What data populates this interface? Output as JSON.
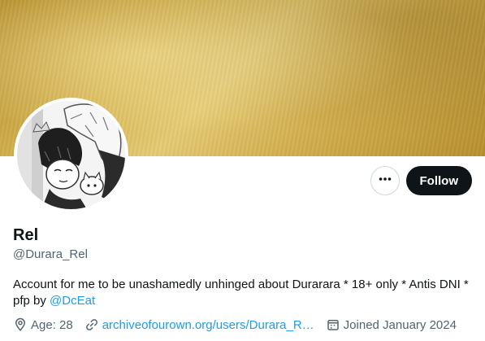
{
  "profile": {
    "name": "Rel",
    "handle": "@Durara_Rel",
    "bio_text": "Account for me to be unashamedly unhinged about Durarara * 18+ only * Antis DNI * pfp by ",
    "bio_mention": "@DcEat"
  },
  "actions": {
    "more_icon": "more-dots-icon",
    "follow_label": "Follow"
  },
  "meta": {
    "location": "Age: 28",
    "website": "archiveofourown.org/users/Durara_R…",
    "joined": "Joined January 2024"
  },
  "colors": {
    "text_primary": "#0f1419",
    "text_secondary": "#536471",
    "link": "#1d9bf0",
    "follow_bg": "#0f1419",
    "banner_gold": "#d7b553"
  }
}
